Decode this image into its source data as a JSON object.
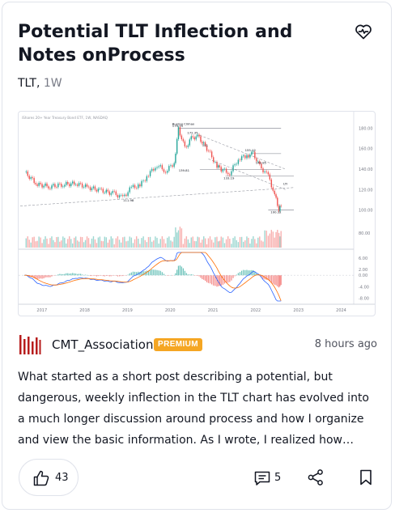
{
  "post": {
    "title": "Potential TLT Inflection and Notes onProcess",
    "symbol": "TLT,",
    "interval": "1W",
    "author": "CMT_Association",
    "badge": "PREMIUM",
    "time_ago": "8 hours ago",
    "description": "What started as a short post describing a potential, but dangerous, weekly inflection in the TLT chart has evolved into a much longer discussion around process and how I organize and view the basic information. As I wrote, I realized how difficult i…",
    "likes": "43",
    "comments": "5"
  },
  "icons": {
    "favorite": "heart-pulse-icon",
    "author_logo": "cmt-bars-logo",
    "like": "thumbs-up-icon",
    "comments": "comment-icon",
    "share": "share-icon",
    "bookmark": "bookmark-icon"
  },
  "colors": {
    "badge": "#f5a623",
    "author_logo": "#b71c1c",
    "price_up": "#26a69a",
    "price_down": "#ef5350",
    "macd_line": "#2962ff",
    "signal_line": "#ff6d00"
  },
  "chart_data": {
    "type": "line",
    "title": "iShares 20+ Year Treasury Bond ETF, 1W, NASDAQ",
    "x_ticks": [
      "2017",
      "2018",
      "2019",
      "2020",
      "2021",
      "2022",
      "2023",
      "2024"
    ],
    "price_ticks": [
      "180.00",
      "160.00",
      "140.00",
      "120.00",
      "100.00"
    ],
    "volume_ticks": [
      "80.00"
    ],
    "macd_ticks": [
      "6.00",
      "2.00",
      "0.00",
      "-4.00",
      "-8.00"
    ],
    "annotations": [
      "Buying Climax",
      "179.70",
      "172.35",
      "155.12",
      "151",
      "139.81",
      "142.85",
      "133.19",
      "LTI",
      "111.98",
      "100.12"
    ],
    "price": {
      "x": [
        2016.6,
        2016.9,
        2017.2,
        2017.5,
        2017.8,
        2018.1,
        2018.4,
        2018.7,
        2018.9,
        2019.1,
        2019.3,
        2019.5,
        2019.7,
        2019.9,
        2020.1,
        2020.2,
        2020.35,
        2020.5,
        2020.65,
        2020.9,
        2021.1,
        2021.2,
        2021.4,
        2021.6,
        2021.8,
        2021.95,
        2022.1,
        2022.3,
        2022.45,
        2022.55,
        2022.6
      ],
      "y": [
        137,
        125,
        123,
        125,
        126,
        122,
        119,
        116,
        112,
        122,
        124,
        135,
        144,
        138,
        146,
        179.7,
        160,
        170,
        172.35,
        158,
        143,
        139.8,
        136,
        150,
        153,
        155.1,
        142.8,
        133.2,
        115,
        100.1,
        104
      ]
    }
  }
}
